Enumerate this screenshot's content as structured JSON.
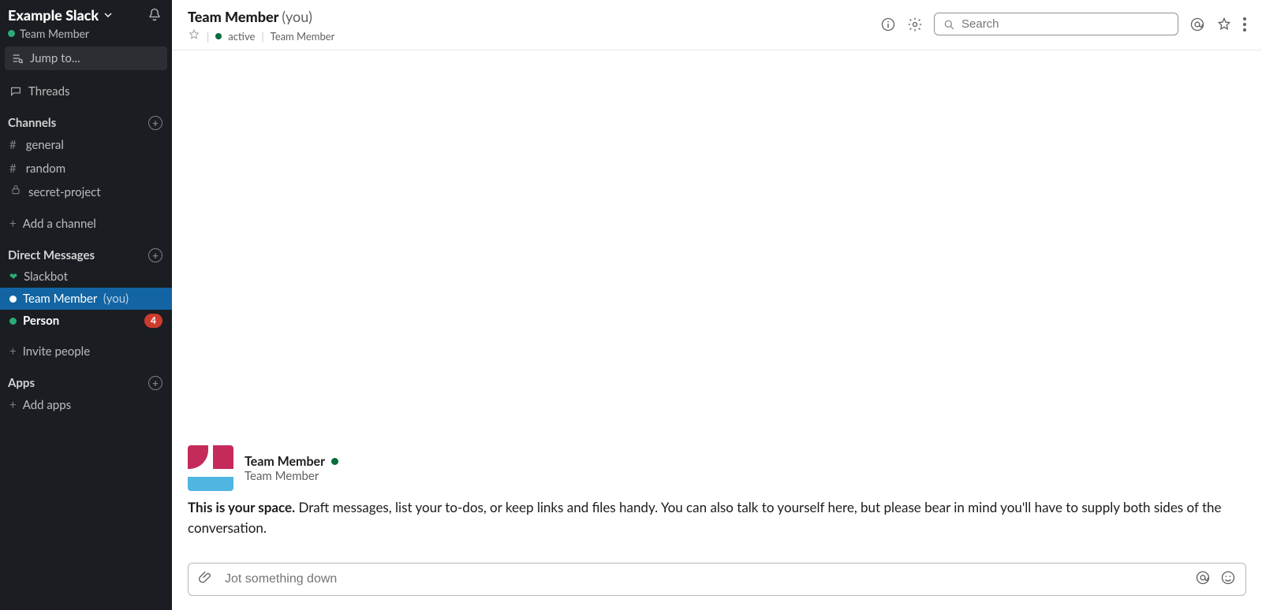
{
  "workspace": {
    "name": "Example Slack",
    "current_user": "Team Member"
  },
  "sidebar": {
    "jump_to": "Jump to...",
    "threads": "Threads",
    "channels_header": "Channels",
    "channels": [
      {
        "name": "general",
        "type": "public"
      },
      {
        "name": "random",
        "type": "public"
      },
      {
        "name": "secret-project",
        "type": "private"
      }
    ],
    "add_channel": "Add a channel",
    "dms_header": "Direct Messages",
    "dms": [
      {
        "name": "Slackbot",
        "presence": "heart",
        "you": false,
        "unread": 0,
        "active": false
      },
      {
        "name": "Team Member",
        "presence": "self",
        "you": true,
        "unread": 0,
        "active": true
      },
      {
        "name": "Person",
        "presence": "active",
        "you": false,
        "unread": 4,
        "active": false
      }
    ],
    "invite_people": "Invite people",
    "apps_header": "Apps",
    "add_apps": "Add apps",
    "you_suffix": "(you)"
  },
  "header": {
    "title": "Team Member",
    "you_suffix": "(you)",
    "status": "active",
    "subtitle_name": "Team Member",
    "search_placeholder": "Search"
  },
  "intro": {
    "name": "Team Member",
    "sub": "Team Member",
    "strong": "This is your space.",
    "body": "Draft messages, list your to-dos, or keep links and files handy. You can also talk to yourself here, but please bear in mind you'll have to supply both sides of the conversation."
  },
  "composer": {
    "placeholder": "Jot something down"
  }
}
